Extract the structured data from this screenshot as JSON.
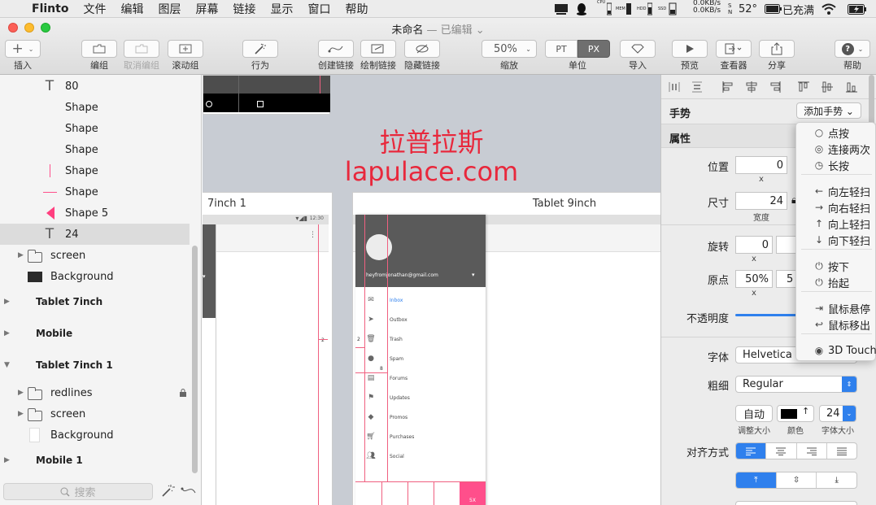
{
  "menubar": {
    "app_name": "Flinto",
    "items": [
      "文件",
      "编辑",
      "图层",
      "屏幕",
      "链接",
      "显示",
      "窗口",
      "帮助"
    ],
    "status": {
      "cpu": "CPU",
      "mem": "MEM",
      "hdd": "HDD",
      "ssd": "SSD",
      "net_up": "0.0KB/s",
      "net_down": "0.0KB/s",
      "sn": "S N",
      "temp": "52°",
      "battery": "已充满"
    }
  },
  "window": {
    "title": "未命名",
    "title_status": "— 已编辑 ⌄"
  },
  "toolbar": {
    "insert": "插入",
    "group": "编组",
    "ungroup": "取消编组",
    "scroll_group": "滚动组",
    "behavior": "行为",
    "create_link": "创建链接",
    "draw_link": "绘制链接",
    "hide_link": "隐藏链接",
    "zoom_value": "50%",
    "zoom_label": "缩放",
    "unit_pt": "PT",
    "unit_px": "PX",
    "unit_label": "单位",
    "import": "导入",
    "preview": "预览",
    "viewer": "查看器",
    "share": "分享",
    "help": "帮助"
  },
  "layers": [
    {
      "label": "80",
      "icon": "text"
    },
    {
      "label": "Shape",
      "icon": "none"
    },
    {
      "label": "Shape",
      "icon": "none"
    },
    {
      "label": "Shape",
      "icon": "none"
    },
    {
      "label": "Shape",
      "icon": "vline"
    },
    {
      "label": "Shape",
      "icon": "hline"
    },
    {
      "label": "Shape 5",
      "icon": "triangle"
    },
    {
      "label": "24",
      "icon": "text"
    },
    {
      "label": "screen",
      "icon": "folder"
    },
    {
      "label": "Background",
      "icon": "blackrect"
    },
    {
      "label": "Tablet 7inch",
      "icon": "group"
    },
    {
      "label": "Mobile",
      "icon": "group"
    },
    {
      "label": "Tablet 7inch 1",
      "icon": "group"
    },
    {
      "label": "redlines",
      "icon": "folder"
    },
    {
      "label": "screen",
      "icon": "folder"
    },
    {
      "label": "Background",
      "icon": "whiterect"
    },
    {
      "label": "Mobile 1",
      "icon": "group"
    }
  ],
  "search_placeholder": "搜索",
  "canvas": {
    "watermark_cn": "拉普拉斯",
    "watermark_en": "lapulace.com",
    "artboard_left_title": "7inch 1",
    "artboard_right_title": "Tablet 9inch",
    "status_time": "12:30",
    "email": "heyfromjonathan@gmail.com",
    "nav": [
      "Inbox",
      "Outbox",
      "Trash",
      "Spam",
      "Forums",
      "Updates",
      "Promos",
      "Purchases",
      "Social"
    ],
    "redline_2a": "2",
    "redline_2b": "2",
    "redline_8": "8",
    "fab": "5X"
  },
  "inspector": {
    "gesture_label": "手势",
    "add_gesture": "添加手势 ⌄",
    "props_label": "属性",
    "position": "位置",
    "position_x": "0",
    "x_a": "x",
    "size": "尺寸",
    "size_w": "24",
    "width_label": "宽度",
    "rotation": "旋转",
    "rotation_x": "0",
    "x_b": "x",
    "origin": "原点",
    "origin_x": "50%",
    "origin_y_partial": "5",
    "x_c": "x",
    "opacity": "不透明度",
    "font": "字体",
    "font_value": "Helvetica",
    "weight": "粗细",
    "weight_value": "Regular",
    "auto_size": "自动",
    "auto_size_label": "调整大小",
    "color_label": "颜色",
    "font_size": "24",
    "font_size_label": "字体大小",
    "align": "对齐方式"
  },
  "gesture_menu": [
    {
      "label": "点按",
      "icon": "○"
    },
    {
      "label": "连接两次",
      "icon": "◎"
    },
    {
      "label": "长按",
      "icon": "◷"
    },
    {
      "label": "向左轻扫",
      "icon": "←"
    },
    {
      "label": "向右轻扫",
      "icon": "→"
    },
    {
      "label": "向上轻扫",
      "icon": "↑"
    },
    {
      "label": "向下轻扫",
      "icon": "↓"
    },
    {
      "label": "按下",
      "icon": "⏻"
    },
    {
      "label": "抬起",
      "icon": "⏻"
    },
    {
      "label": "鼠标悬停",
      "icon": "⇥"
    },
    {
      "label": "鼠标移出",
      "icon": "↩"
    },
    {
      "label": "3D Touch",
      "icon": "◉"
    }
  ],
  "colors": {
    "accent": "#2f80ed",
    "watermark": "#e8283c",
    "pink": "#ff4f8b",
    "redline": "#f06080"
  }
}
